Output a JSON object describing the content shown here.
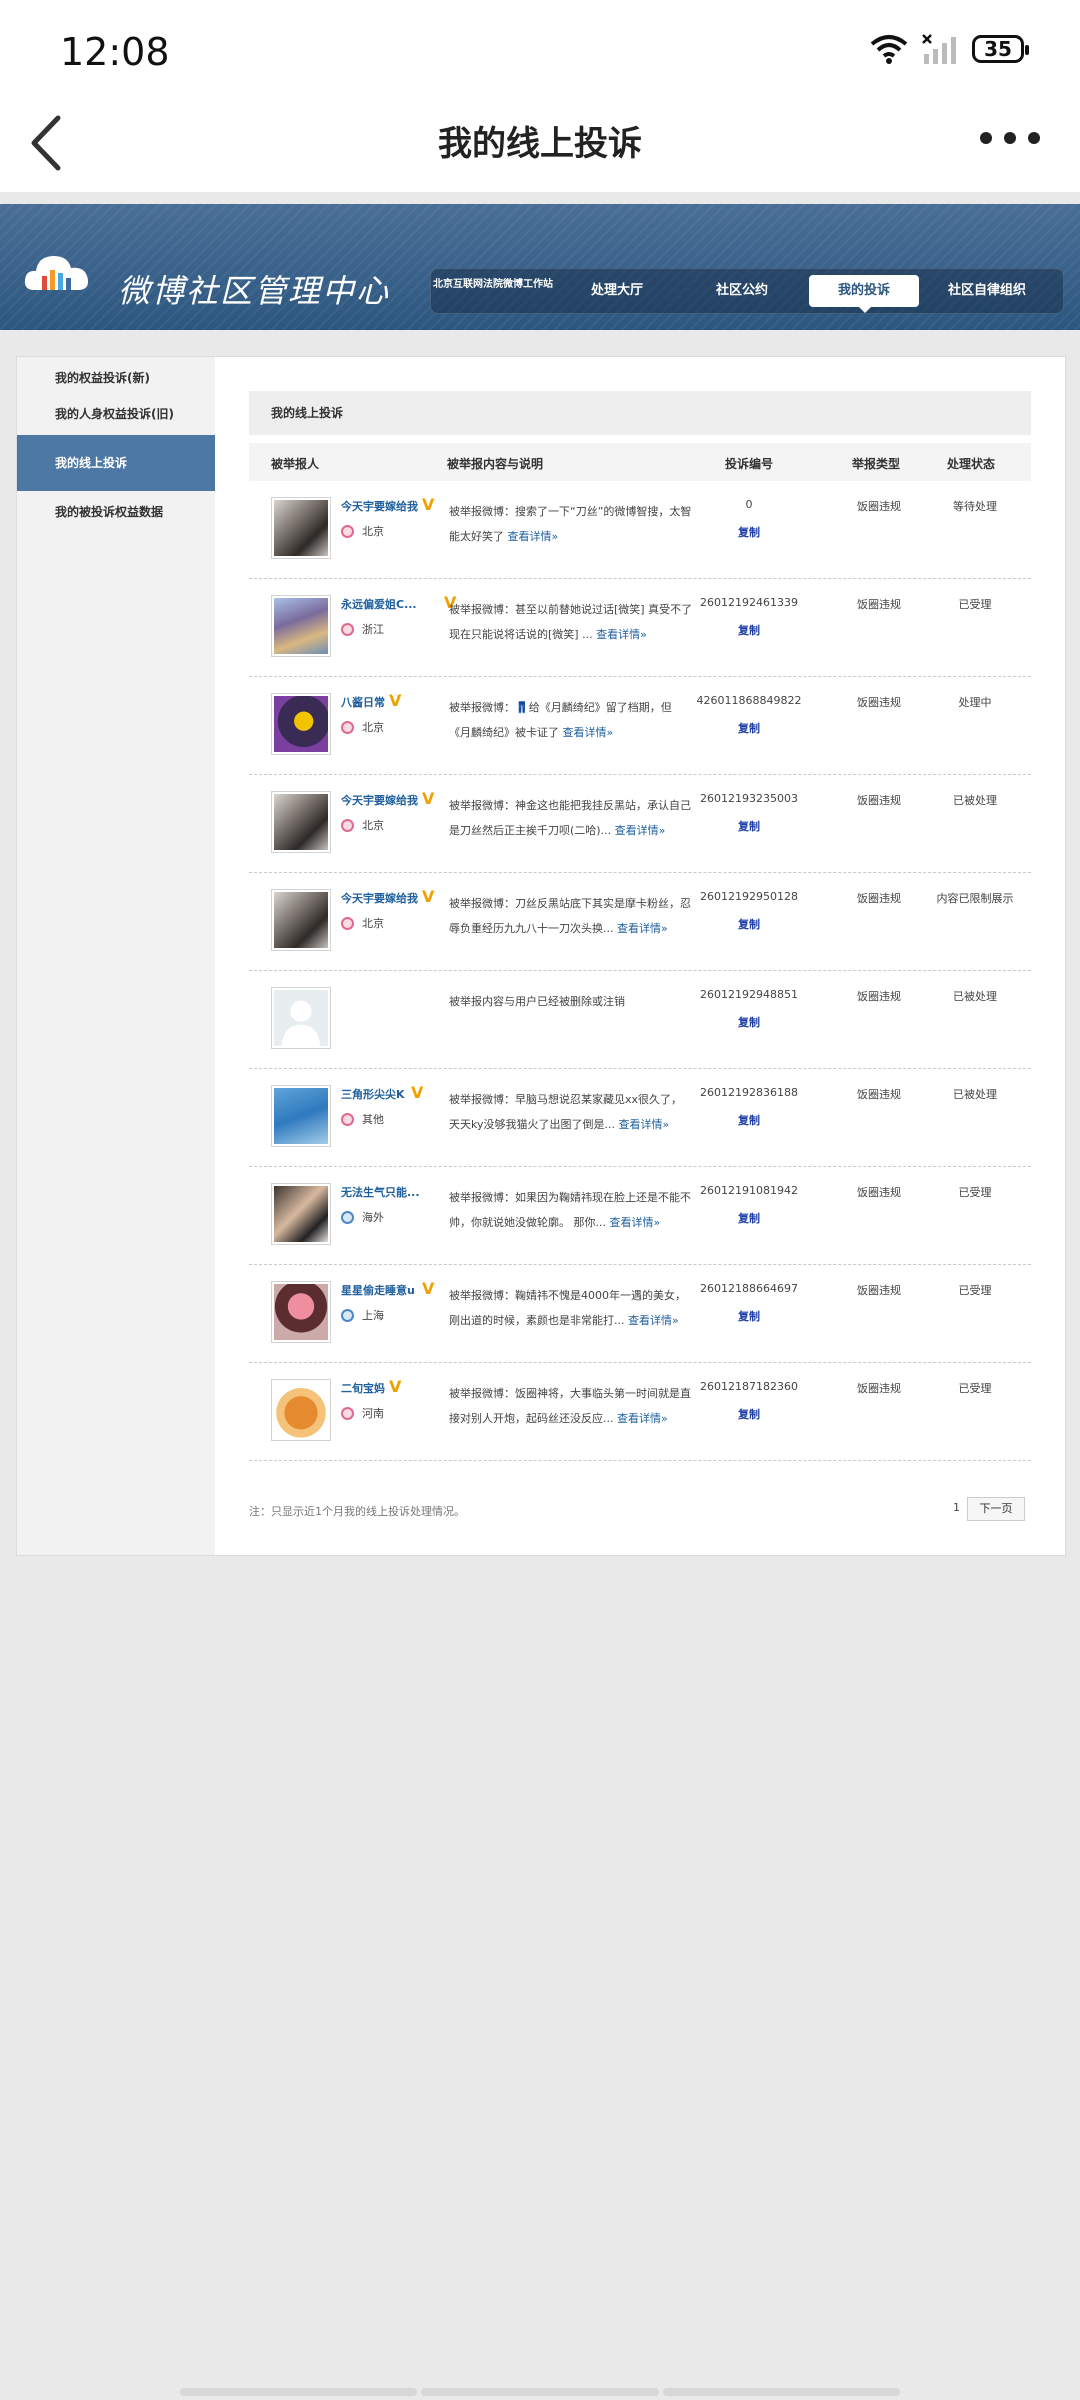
{
  "status_bar": {
    "time": "12:08",
    "battery": "35"
  },
  "app_bar": {
    "title": "我的线上投诉"
  },
  "banner": {
    "brand": "微博社区管理中心",
    "nav": [
      {
        "label": "北京互联网法院微博工作站"
      },
      {
        "label": "处理大厅"
      },
      {
        "label": "社区公约"
      },
      {
        "label": "我的投诉"
      },
      {
        "label": "社区自律组织"
      }
    ]
  },
  "sidebar": {
    "items": [
      {
        "label": "我的权益投诉(新)"
      },
      {
        "label": "我的人身权益投诉(旧)"
      },
      {
        "label": "我的线上投诉"
      },
      {
        "label": "我的被投诉权益数据"
      }
    ]
  },
  "main": {
    "title": "我的线上投诉",
    "columns": [
      "被举报人",
      "被举报内容与说明",
      "投诉编号",
      "举报类型",
      "处理状态"
    ],
    "copy_label": "复制",
    "rows": [
      {
        "user": "今天宇要嫁给我",
        "loc": "北京",
        "desc": "被举报微博：搜索了一下“刀丝”的微博智搜，太智能太好笑了",
        "more": "查看详情»",
        "code": "0",
        "type": "饭圈违规",
        "status": "等待处理"
      },
      {
        "user": "永远偏爱姐C...",
        "loc": "浙江",
        "desc": "被举报微博：甚至以前替她说过话[微笑] 真受不了现在只能说将话说的[微笑] ...",
        "more": "查看详情»",
        "code": "26012192461339",
        "type": "饭圈违规",
        "status": "已受理"
      },
      {
        "user": "八酱日常",
        "loc": "北京",
        "desc": "被举报微博：👖给《月麟绮纪》留了档期，但《月麟绮纪》被卡证了",
        "more": "查看详情»",
        "code": "426011868849822",
        "type": "饭圈违规",
        "status": "处理中"
      },
      {
        "user": "今天宇要嫁给我",
        "loc": "北京",
        "desc": "被举报微博：神金这也能把我挂反黑站，承认自己是刀丝然后正主挨千刀呗(二哈)...",
        "more": "查看详情»",
        "code": "26012193235003",
        "type": "饭圈违规",
        "status": "已被处理"
      },
      {
        "user": "今天宇要嫁给我",
        "loc": "北京",
        "desc": "被举报微博：刀丝反黑站底下其实是摩卡粉丝，忍辱负重经历九九八十一刀次头换...",
        "more": "查看详情»",
        "code": "26012192950128",
        "type": "饭圈违规",
        "status": "内容已限制展示"
      },
      {
        "user": "",
        "loc": "",
        "desc": "被举报内容与用户已经被删除或注销",
        "more": "",
        "code": "26012192948851",
        "type": "饭圈违规",
        "status": "已被处理"
      },
      {
        "user": "三角形尖尖K",
        "loc": "其他",
        "desc": "被举报微博：早脑马想说忍某家藏见xx很久了，天天ky没够我猫火了出图了倒是...",
        "more": "查看详情»",
        "code": "26012192836188",
        "type": "饭圈违规",
        "status": "已被处理"
      },
      {
        "user": "无法生气只能...",
        "loc": "海外",
        "desc": "被举报微博：如果因为鞠婧祎现在脸上还是不能不帅，你就说她没做轮廓。 那你...",
        "more": "查看详情»",
        "code": "26012191081942",
        "type": "饭圈违规",
        "status": "已受理"
      },
      {
        "user": "星星偷走睡意u",
        "loc": "上海",
        "desc": "被举报微博：鞠婧祎不愧是4000年一遇的美女，刚出道的时候，素颜也是非常能打...",
        "more": "查看详情»",
        "code": "26012188664697",
        "type": "饭圈违规",
        "status": "已受理"
      },
      {
        "user": "二旬宝妈",
        "loc": "河南",
        "desc": "被举报微博：饭圈神将，大事临头第一时间就是直接对别人开炮，起码丝还没反应...",
        "more": "查看详情»",
        "code": "26012187182360",
        "type": "饭圈违规",
        "status": "已受理"
      }
    ],
    "note": "注：只显示近1个月我的线上投诉处理情况。",
    "page": "1",
    "next_label": "下一页"
  }
}
